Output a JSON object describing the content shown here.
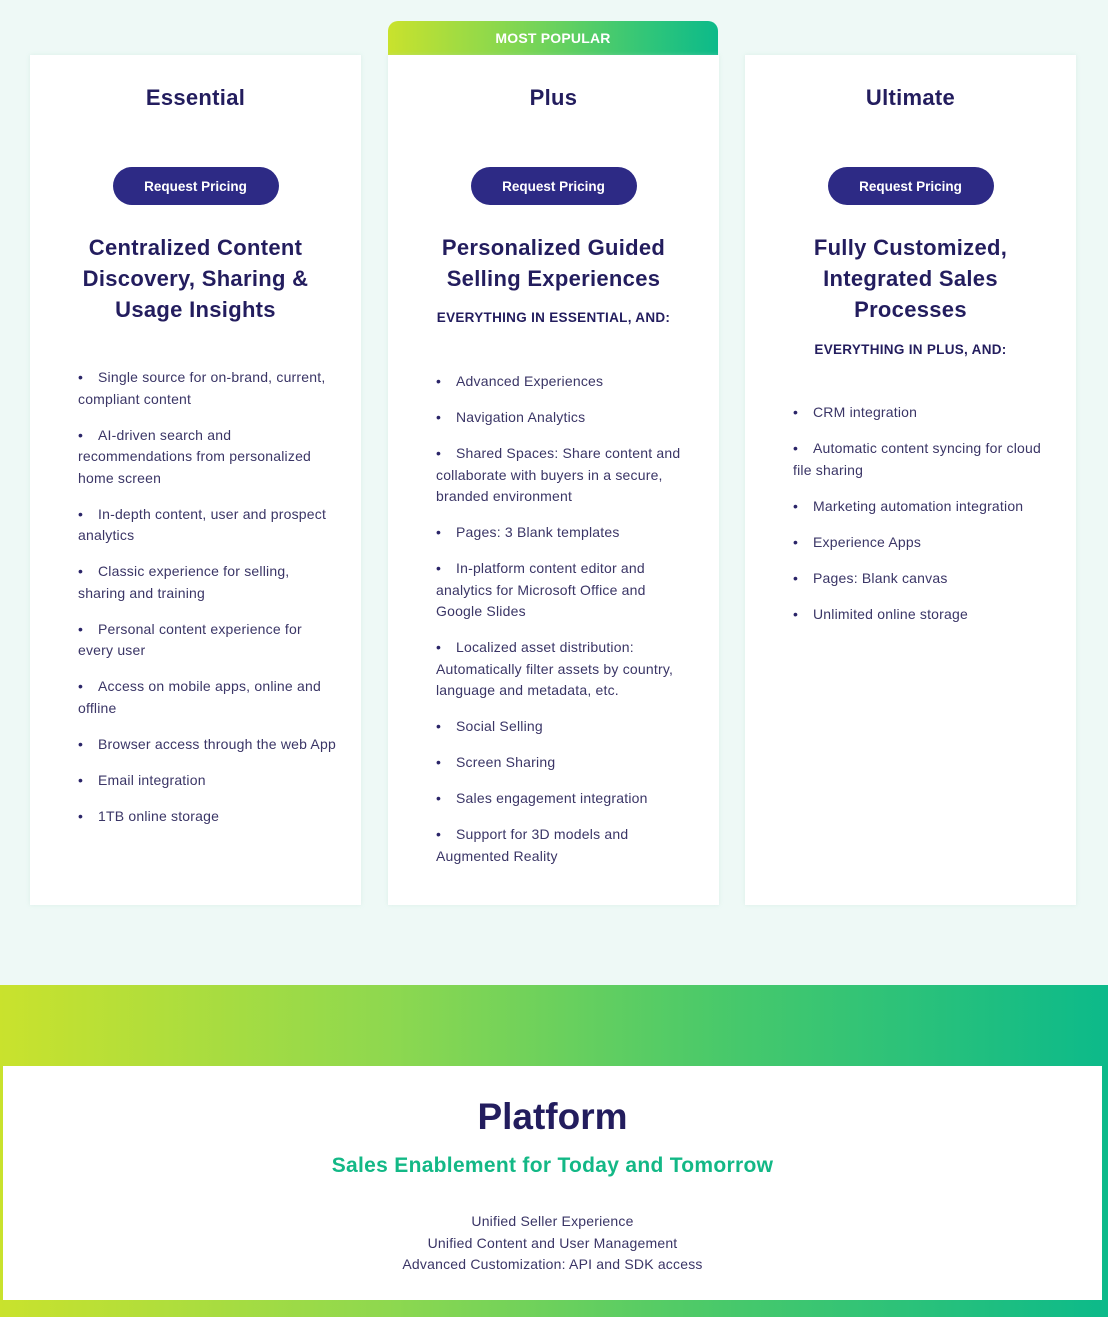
{
  "badge": {
    "label": "MOST POPULAR"
  },
  "colors": {
    "primary_navy": "#231d5e",
    "button": "#2d2a85",
    "accent_green": "#13b886",
    "gradient_start": "#c9e22d",
    "gradient_end": "#0cba8a",
    "page_background": "#eef9f6"
  },
  "plans": [
    {
      "name": "Essential",
      "cta": "Request Pricing",
      "tagline": "Centralized Content Discovery, Sharing & Usage Insights",
      "subhead": "",
      "features": [
        "Single source for on-brand, current, compliant content",
        "AI-driven search and recommendations from personalized home screen",
        "In-depth content, user and prospect analytics",
        "Classic experience for selling, sharing and training",
        "Personal content experience for every user",
        "Access on mobile apps, online and offline",
        "Browser access through the web App",
        "Email integration",
        "1TB online storage"
      ]
    },
    {
      "name": "Plus",
      "cta": "Request Pricing",
      "tagline": "Personalized Guided Selling Experiences",
      "subhead": "EVERYTHING IN ESSENTIAL, AND:",
      "features": [
        "Advanced Experiences",
        "Navigation Analytics",
        "Shared Spaces: Share content and collaborate with buyers in a secure, branded environment",
        "Pages: 3 Blank templates",
        "In-platform content editor and analytics for Microsoft Office and Google Slides",
        "Localized asset distribution: Automatically filter assets by country, language and metadata, etc.",
        "Social Selling",
        "Screen Sharing",
        "Sales engagement integration",
        "Support for 3D models and Augmented Reality"
      ]
    },
    {
      "name": "Ultimate",
      "cta": "Request Pricing",
      "tagline": "Fully Customized, Integrated Sales Processes",
      "subhead": "EVERYTHING IN PLUS, AND:",
      "features": [
        "CRM integration",
        "Automatic content syncing for cloud file sharing",
        "Marketing automation integration",
        "Experience Apps",
        "Pages: Blank canvas",
        "Unlimited online storage"
      ]
    }
  ],
  "platform": {
    "title": "Platform",
    "subtitle": "Sales Enablement for Today and Tomorrow",
    "points": [
      "Unified Seller Experience",
      "Unified Content and User Management",
      "Advanced Customization: API and SDK access"
    ]
  },
  "bullet_glyph": "•"
}
